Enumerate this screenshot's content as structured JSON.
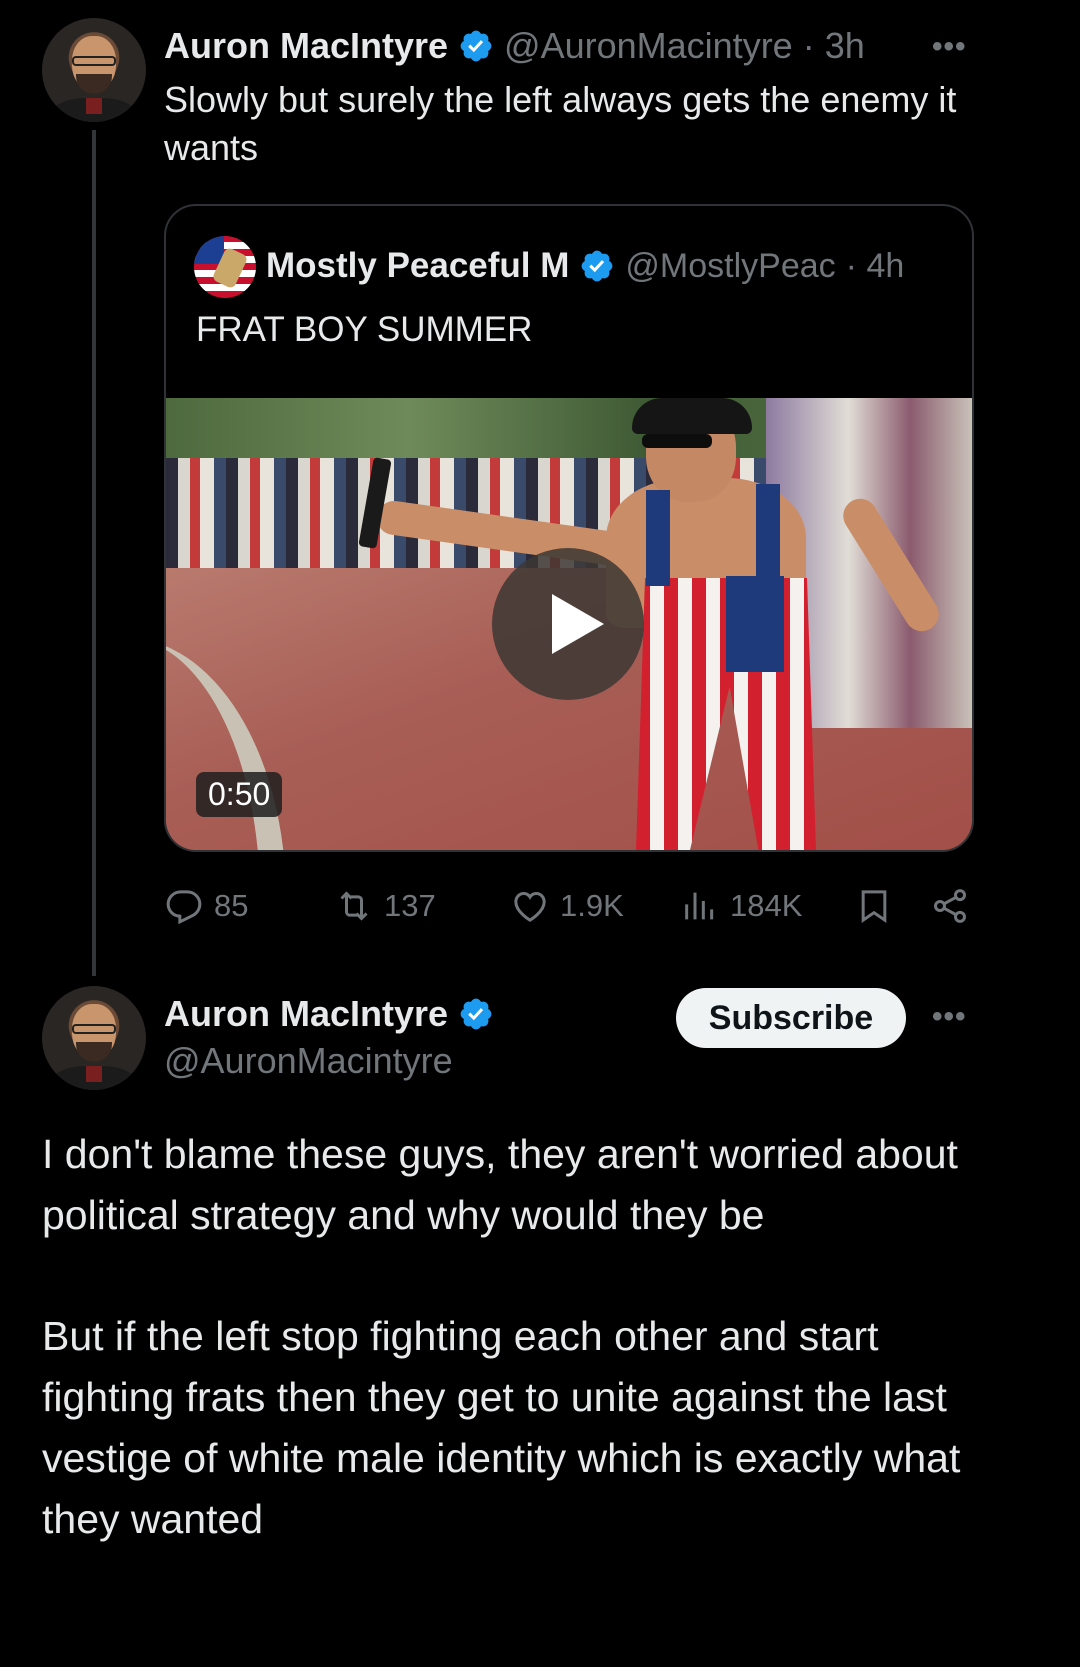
{
  "quoting_tweet": {
    "author_name": "Auron MacIntyre",
    "author_handle": "@AuronMacintyre",
    "time": "· 3h",
    "more": "•••",
    "text": "Slowly but surely the left always gets the enemy it wants"
  },
  "quoted_tweet": {
    "author_name": "Mostly Peaceful M",
    "author_handle": "@MostlyPeac",
    "time": "· 4h",
    "text": "FRAT BOY SUMMER",
    "video_duration": "0:50"
  },
  "actions": {
    "replies": "85",
    "reposts": "137",
    "likes": "1.9K",
    "views": "184K"
  },
  "reply_tweet": {
    "author_name": "Auron MacIntyre",
    "author_handle": "@AuronMacintyre",
    "subscribe_label": "Subscribe",
    "more": "•••",
    "paragraph_1": "I don't blame these guys, they aren't worried about political strategy and why would they be",
    "paragraph_2": "But if the left stop fighting each other and start fighting frats then they get to unite against the last vestige of white male identity which is exactly what they wanted"
  },
  "colors": {
    "background": "#000000",
    "primary_text": "#e7e9ea",
    "secondary_text": "#71767b",
    "verified_blue": "#1d9bf0",
    "border": "#2f3336"
  },
  "icons": [
    "verified-badge-icon",
    "more-icon",
    "play-icon",
    "reply-icon",
    "repost-icon",
    "like-icon",
    "views-icon",
    "bookmark-icon",
    "share-icon"
  ]
}
